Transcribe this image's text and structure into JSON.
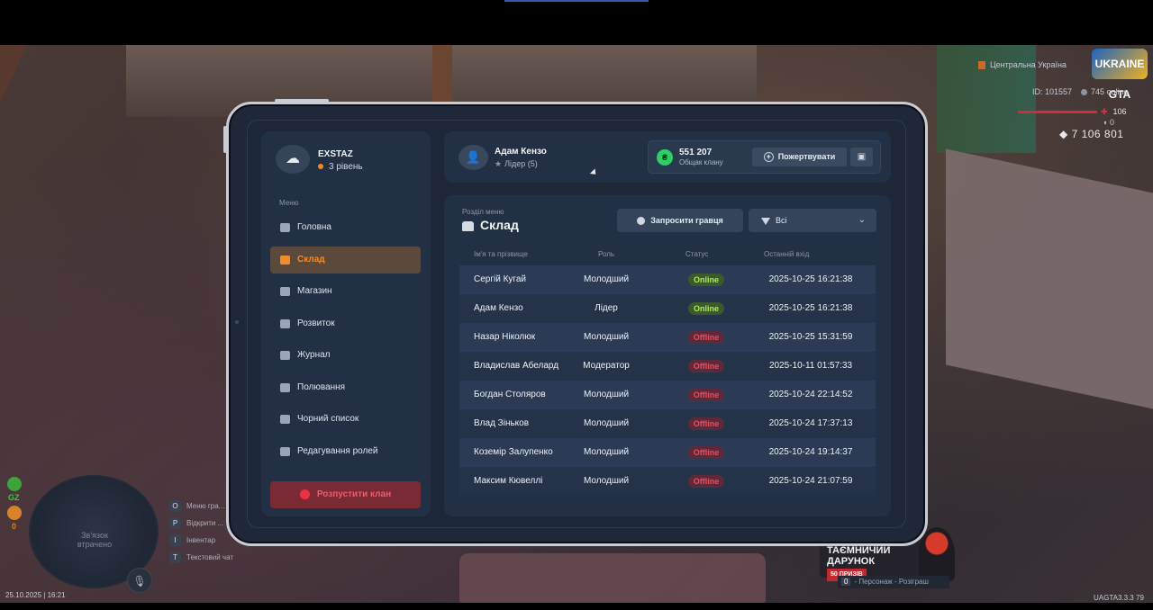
{
  "hud": {
    "region": "Центральна Україна",
    "logo": "UKRAINE GTA",
    "player_id": "ID: 101557",
    "online": "745 online",
    "health": "106",
    "armor": "0",
    "money": "7 106 801",
    "map_status": "Зв'язок втрачено",
    "gz_label": "GZ",
    "gz_count": "0",
    "hints": [
      {
        "key": "O",
        "label": "Меню гра..."
      },
      {
        "key": "P",
        "label": "Відкрити ..."
      },
      {
        "key": "I",
        "label": "Інвентар"
      },
      {
        "key": "T",
        "label": "Текстовий чат"
      }
    ],
    "datetime": "25.10.2025 | 16:21",
    "version": "UAGTA3.3.3",
    "version_suffix": "79",
    "gift_title": "ТАЄМНИЧИЙ ДАРУНОК",
    "gift_sub": "50 ПРИЗІВ",
    "gift_key": "0",
    "gift_hint": "- Персонаж - Розіграш"
  },
  "clan": {
    "logo_icon": "☁",
    "name": "EXSTAZ",
    "level": "3 рівень",
    "level_dot_color": "#f08a24"
  },
  "menu": {
    "label": "Меню",
    "items": [
      {
        "label": "Головна",
        "icon": "home-icon",
        "active": false
      },
      {
        "label": "Склад",
        "icon": "users-icon",
        "active": true
      },
      {
        "label": "Магазин",
        "icon": "shop-icon",
        "active": false
      },
      {
        "label": "Розвиток",
        "icon": "chart-icon",
        "active": false
      },
      {
        "label": "Журнал",
        "icon": "book-icon",
        "active": false
      },
      {
        "label": "Полювання",
        "icon": "target-icon",
        "active": false
      },
      {
        "label": "Чорний список",
        "icon": "block-icon",
        "active": false
      },
      {
        "label": "Редагування ролей",
        "icon": "user-gear-icon",
        "active": false
      }
    ],
    "disband_label": "Розпустити клан"
  },
  "player": {
    "avatar_icon": "👤",
    "name": "Адам Кензо",
    "star": "★",
    "role": "Лідер (5)"
  },
  "fund": {
    "icon": "₴",
    "amount": "551 207",
    "label": "Общак клану",
    "donate_label": "Пожертвувати",
    "donate_icon": "+",
    "wallet_icon": "▣"
  },
  "section": {
    "label": "Розділ меню",
    "title": "Склад",
    "invite_label": "Запросити гравця",
    "filter_value": "Всі",
    "filter_chevron": "⌄"
  },
  "table": {
    "headers": [
      "Ім'я та прізвище",
      "Роль",
      "Статус",
      "Останній вхід"
    ],
    "rows": [
      {
        "name": "Сергій Кугай",
        "role": "Молодший",
        "status": "Online",
        "last": "2025-10-25 16:21:38"
      },
      {
        "name": "Адам Кензо",
        "role": "Лідер",
        "status": "Online",
        "last": "2025-10-25 16:21:38"
      },
      {
        "name": "Назар Ніколюк",
        "role": "Молодший",
        "status": "Offline",
        "last": "2025-10-25 15:31:59"
      },
      {
        "name": "Владислав Абелард",
        "role": "Модератор",
        "status": "Offline",
        "last": "2025-10-11 01:57:33"
      },
      {
        "name": "Богдан Столяров",
        "role": "Молодший",
        "status": "Offline",
        "last": "2025-10-24 22:14:52"
      },
      {
        "name": "Влад Зіньков",
        "role": "Молодший",
        "status": "Offline",
        "last": "2025-10-24 17:37:13"
      },
      {
        "name": "Коземір Залупенко",
        "role": "Молодший",
        "status": "Offline",
        "last": "2025-10-24 19:14:37"
      },
      {
        "name": "Максим Кювеллі",
        "role": "Молодший",
        "status": "Offline",
        "last": "2025-10-24 21:07:59"
      }
    ]
  },
  "colors": {
    "accent": "#f28c28",
    "online": "#a8f04a",
    "offline": "#f24a5e",
    "danger": "#f0303f",
    "panel": "#223046"
  }
}
